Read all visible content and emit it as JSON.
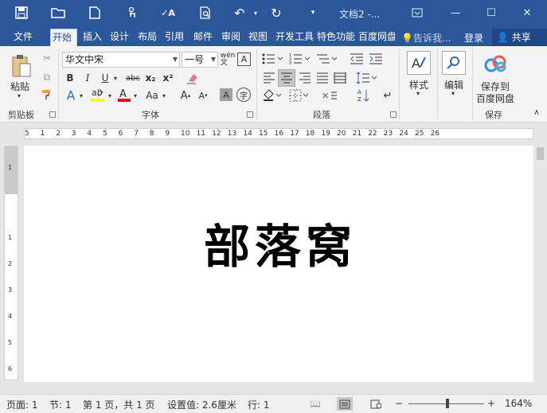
{
  "title_bar": {
    "doc_title": "文档2 -...",
    "qat_icons": [
      "save-icon",
      "open-folder-icon",
      "new-document-icon",
      "touch-mode-icon",
      "spelling-icon",
      "print-preview-icon",
      "undo-icon",
      "redo-icon",
      "customize-qat-icon"
    ],
    "window_buttons": [
      "ribbon-display-icon",
      "minimize-icon",
      "maximize-icon",
      "close-icon"
    ]
  },
  "tabs": [
    "文件",
    "开始",
    "插入",
    "设计",
    "布局",
    "引用",
    "邮件",
    "审阅",
    "视图",
    "开发工具",
    "特色功能",
    "百度网盘"
  ],
  "active_tab": "开始",
  "tell_me": "告诉我...",
  "login": "登录",
  "share": "共享",
  "ribbon": {
    "clipboard": {
      "paste": "粘贴",
      "label": "剪贴板"
    },
    "font": {
      "font_name": "华文中宋",
      "font_size": "一号",
      "label": "字体",
      "buttons": [
        "B",
        "I",
        "U",
        "abc",
        "x₂",
        "x²",
        "A",
        "A",
        "A",
        "A",
        "Aa",
        "A",
        "字"
      ]
    },
    "paragraph": {
      "label": "段落"
    },
    "styles": {
      "label": "样式"
    },
    "editing": {
      "label": "编辑"
    },
    "save": {
      "line1": "保存到",
      "line2": "百度网盘",
      "label": "保存"
    }
  },
  "ruler_h_numbers": [
    "5",
    "1",
    "2",
    "3",
    "4",
    "5",
    "6",
    "7",
    "8",
    "9",
    "10",
    "11",
    "12",
    "13",
    "14",
    "15",
    "16",
    "17",
    "18",
    "19",
    "20",
    "21",
    "22",
    "23",
    "24",
    "25",
    "26"
  ],
  "ruler_v_numbers": [
    "1",
    "1",
    "2",
    "3",
    "4",
    "5",
    "6"
  ],
  "document": {
    "text": "部落窝"
  },
  "status": {
    "page": "页面: 1",
    "section": "节: 1",
    "pages": "第 1 页，共 1 页",
    "position": "设置值: 2.6厘米",
    "line": "行: 1",
    "zoom_minus": "−",
    "zoom_plus": "+",
    "zoom": "164%"
  },
  "colors": {
    "brand": "#2b579a",
    "highlight_yellow": "#ffff00",
    "font_red": "#ff0000"
  }
}
